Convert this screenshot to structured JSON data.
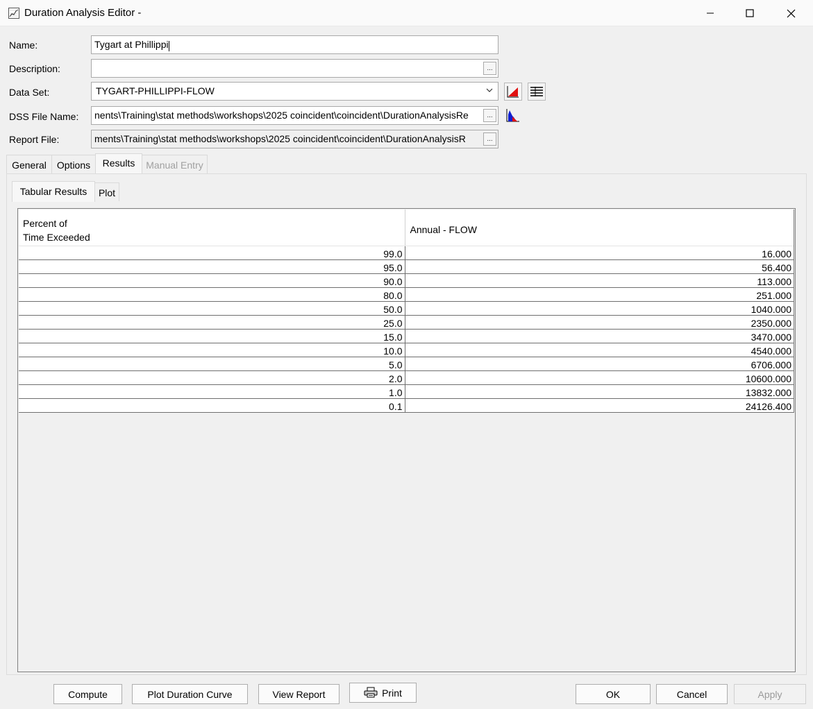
{
  "window": {
    "title": "Duration Analysis Editor -"
  },
  "form": {
    "name_label": "Name:",
    "name_value": "Tygart at Phillippi",
    "description_label": "Description:",
    "description_value": "",
    "dataset_label": "Data Set:",
    "dataset_value": "TYGART-PHILLIPPI-FLOW",
    "dss_label": "DSS File Name:",
    "dss_value": "nents\\Training\\stat methods\\workshops\\2025 coincident\\coincident\\DurationAnalysisRe",
    "report_label": "Report File:",
    "report_value": "ments\\Training\\stat methods\\workshops\\2025 coincident\\coincident\\DurationAnalysisR",
    "browse_label": "..."
  },
  "tabs": {
    "general": "General",
    "options": "Options",
    "results": "Results",
    "manual_entry": "Manual Entry"
  },
  "subtabs": {
    "tabular": "Tabular Results",
    "plot": "Plot"
  },
  "table": {
    "col1_line1": "Percent of",
    "col1_line2": "Time Exceeded",
    "col2": "Annual - FLOW",
    "rows": [
      [
        "99.0",
        "16.000"
      ],
      [
        "95.0",
        "56.400"
      ],
      [
        "90.0",
        "113.000"
      ],
      [
        "80.0",
        "251.000"
      ],
      [
        "50.0",
        "1040.000"
      ],
      [
        "25.0",
        "2350.000"
      ],
      [
        "15.0",
        "3470.000"
      ],
      [
        "10.0",
        "4540.000"
      ],
      [
        "5.0",
        "6706.000"
      ],
      [
        "2.0",
        "10600.000"
      ],
      [
        "1.0",
        "13832.000"
      ],
      [
        "0.1",
        "24126.400"
      ]
    ]
  },
  "buttons": {
    "compute": "Compute",
    "plot_curve": "Plot Duration Curve",
    "view_report": "View Report",
    "print": "Print",
    "ok": "OK",
    "cancel": "Cancel",
    "apply": "Apply"
  }
}
